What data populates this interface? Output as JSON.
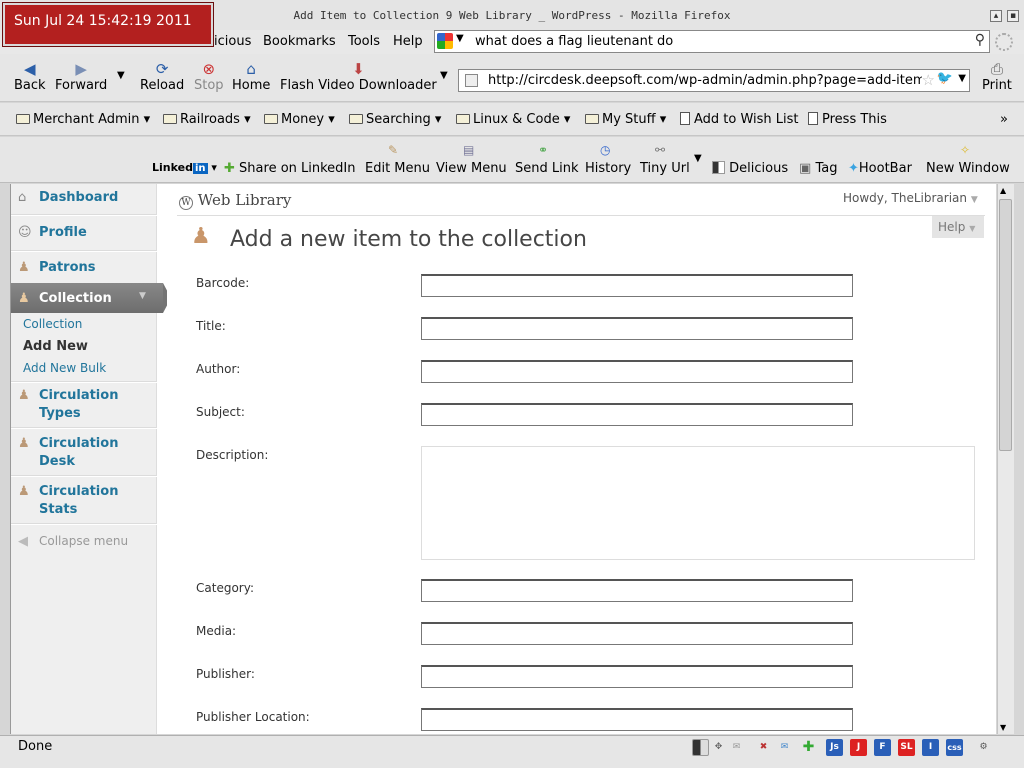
{
  "window": {
    "title": "Add Item to Collection  9 Web Library  _ WordPress - Mozilla Firefox"
  },
  "clock": "Sun Jul 24 15:42:19 2011",
  "menubar": {
    "items": [
      "icious",
      "Bookmarks",
      "Tools",
      "Help"
    ]
  },
  "search": {
    "query": "what does a flag lieutenant do"
  },
  "nav": {
    "back": "Back",
    "forward": "Forward",
    "reload": "Reload",
    "stop": "Stop",
    "home": "Home",
    "flash": "Flash Video Downloader",
    "print": "Print",
    "url": "http://circdesk.deepsoft.com/wp-admin/admin.php?page=add-item"
  },
  "bookmarks": {
    "items": [
      "Merchant Admin",
      "Railroads",
      "Money",
      "Searching",
      "Linux & Code",
      "My Stuff"
    ],
    "wish": "Add to Wish List",
    "press": "Press This",
    "more": "»"
  },
  "addons": {
    "linkedin": "Linked",
    "share": "Share on LinkedIn",
    "edit": "Edit Menu",
    "view": "View Menu",
    "send": "Send Link",
    "history": "History",
    "tiny": "Tiny Url",
    "delicious": "Delicious",
    "tag": "Tag",
    "hootbar": "HootBar",
    "newwin": "New Window"
  },
  "wp": {
    "site_title": "Web Library",
    "howdy": "Howdy, TheLibrarian",
    "help": "Help",
    "page_title": "Add a new item to the collection",
    "menu": {
      "dashboard": "Dashboard",
      "profile": "Profile",
      "patrons": "Patrons",
      "collection": "Collection",
      "sub_collection": "Collection",
      "sub_addnew": "Add New",
      "sub_addbulk": "Add New Bulk",
      "circ_types": "Circulation Types",
      "circ_desk": "Circulation Desk",
      "circ_stats": "Circulation Stats",
      "collapse": "Collapse menu"
    },
    "fields": {
      "barcode": "Barcode:",
      "title": "Title:",
      "author": "Author:",
      "subject": "Subject:",
      "description": "Description:",
      "category": "Category:",
      "media": "Media:",
      "publisher": "Publisher:",
      "publisher_location": "Publisher Location:"
    }
  },
  "status": {
    "text": "Done",
    "icons": [
      "Js",
      "J",
      "F",
      "SL",
      "I",
      "css"
    ]
  }
}
